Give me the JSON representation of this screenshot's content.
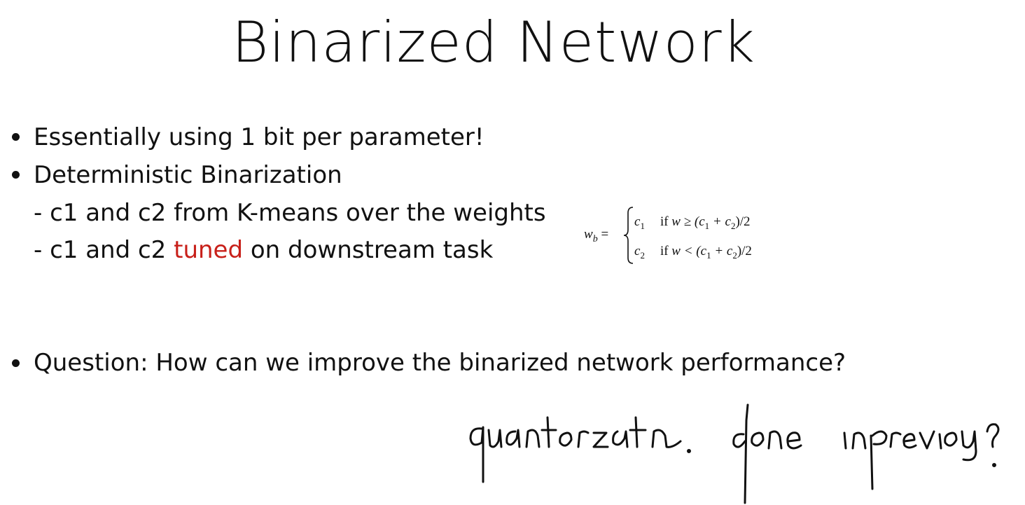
{
  "slide": {
    "title": "Binarized Network",
    "bullets": [
      "Essentially using 1 bit per parameter!",
      "Deterministic Binarization",
      "Question: How can we improve the binarized network performance?"
    ],
    "sub_items": [
      {
        "text": "- c1 and c2 from K-means over the weights"
      },
      {
        "prefix": "- c1 and c2 ",
        "highlight": "tuned",
        "suffix": " on downstream task"
      }
    ],
    "highlight_color": "#c8201a",
    "formula": {
      "lhs_var": "w",
      "lhs_sub": "b",
      "equals": "=",
      "case1_val": "c",
      "case1_sub": "1",
      "case1_cond_if": "if",
      "case1_cond_rel": "w ≥ (c",
      "case1_cond_mid": " + c",
      "case1_cond_end": ")/2",
      "case2_val": "c",
      "case2_sub": "2",
      "case2_cond_if": "if",
      "case2_cond_rel": "w < (c",
      "case2_cond_mid": " + c",
      "case2_cond_end": ")/2",
      "sub1": "1",
      "sub2": "2"
    },
    "handwritten_note": "quantization done in previous?"
  }
}
